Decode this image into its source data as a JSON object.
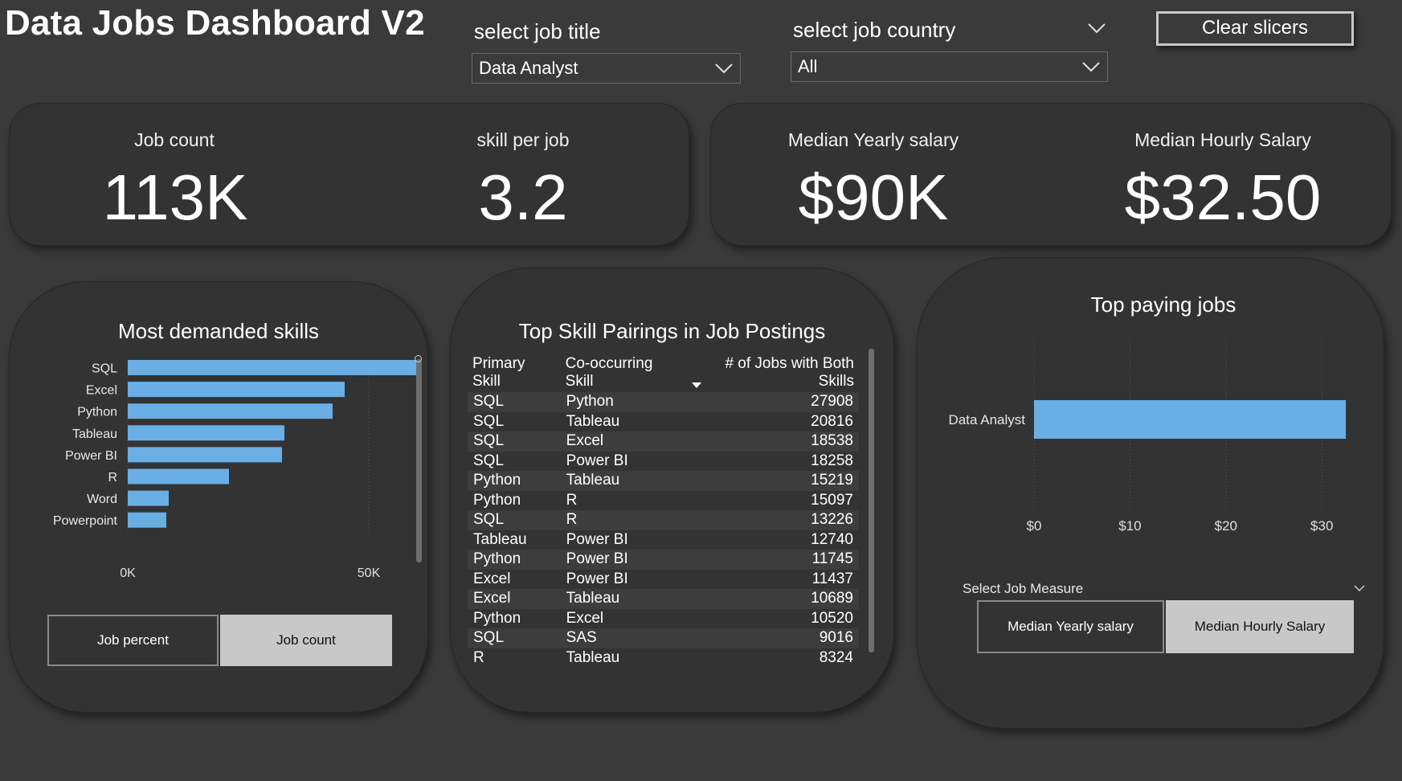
{
  "header": {
    "title": "Data Jobs Dashboard V2",
    "job_title_slicer": {
      "label": "select job title",
      "value": "Data Analyst"
    },
    "job_country_slicer": {
      "label": "select job country",
      "value": "All"
    },
    "clear_button": "Clear slicers"
  },
  "kpis": {
    "job_count": {
      "label": "Job count",
      "value": "113K"
    },
    "skill_per_job": {
      "label": "skill per job",
      "value": "3.2"
    },
    "median_yearly": {
      "label": "Median Yearly salary",
      "value": "$90K"
    },
    "median_hourly": {
      "label": "Median Hourly Salary",
      "value": "$32.50"
    }
  },
  "skills_panel": {
    "title": "Most demanded skills",
    "toggle": {
      "left": "Job percent",
      "right": "Job count",
      "active": "right"
    }
  },
  "pairs_panel": {
    "title": "Top Skill Pairings in Job Postings",
    "columns": [
      "Primary Skill",
      "Co-occurring Skill",
      "# of Jobs with Both Skills"
    ],
    "rows": [
      [
        "SQL",
        "Python",
        "27908"
      ],
      [
        "SQL",
        "Tableau",
        "20816"
      ],
      [
        "SQL",
        "Excel",
        "18538"
      ],
      [
        "SQL",
        "Power BI",
        "18258"
      ],
      [
        "Python",
        "Tableau",
        "15219"
      ],
      [
        "Python",
        "R",
        "15097"
      ],
      [
        "SQL",
        "R",
        "13226"
      ],
      [
        "Tableau",
        "Power BI",
        "12740"
      ],
      [
        "Python",
        "Power BI",
        "11745"
      ],
      [
        "Excel",
        "Power BI",
        "11437"
      ],
      [
        "Excel",
        "Tableau",
        "10689"
      ],
      [
        "Python",
        "Excel",
        "10520"
      ],
      [
        "SQL",
        "SAS",
        "9016"
      ],
      [
        "R",
        "Tableau",
        "8324"
      ]
    ]
  },
  "paying_panel": {
    "title": "Top paying jobs",
    "measure_label": "Select Job Measure",
    "measure_options": [
      "Median Yearly salary",
      "Median Hourly Salary"
    ],
    "measure_active": "Median Hourly Salary"
  },
  "chart_data": [
    {
      "type": "bar",
      "orientation": "horizontal",
      "title": "Most demanded skills",
      "categories": [
        "SQL",
        "Excel",
        "Python",
        "Tableau",
        "Power BI",
        "R",
        "Word",
        "Powerpoint"
      ],
      "values": [
        63000,
        45000,
        42500,
        32500,
        32000,
        21000,
        8500,
        8000
      ],
      "xlim": [
        0,
        60000
      ],
      "tick_labels": [
        "0K",
        "50K"
      ],
      "tick_values": [
        0,
        50000
      ],
      "color": "#6aaee6",
      "grid": true
    },
    {
      "type": "bar",
      "orientation": "horizontal",
      "title": "Top paying jobs",
      "categories": [
        "Data Analyst"
      ],
      "values": [
        32.5
      ],
      "xlim": [
        0,
        34
      ],
      "tick_labels": [
        "$0",
        "$10",
        "$20",
        "$30"
      ],
      "tick_values": [
        0,
        10,
        20,
        30
      ],
      "color": "#6aaee6",
      "grid": true
    }
  ]
}
